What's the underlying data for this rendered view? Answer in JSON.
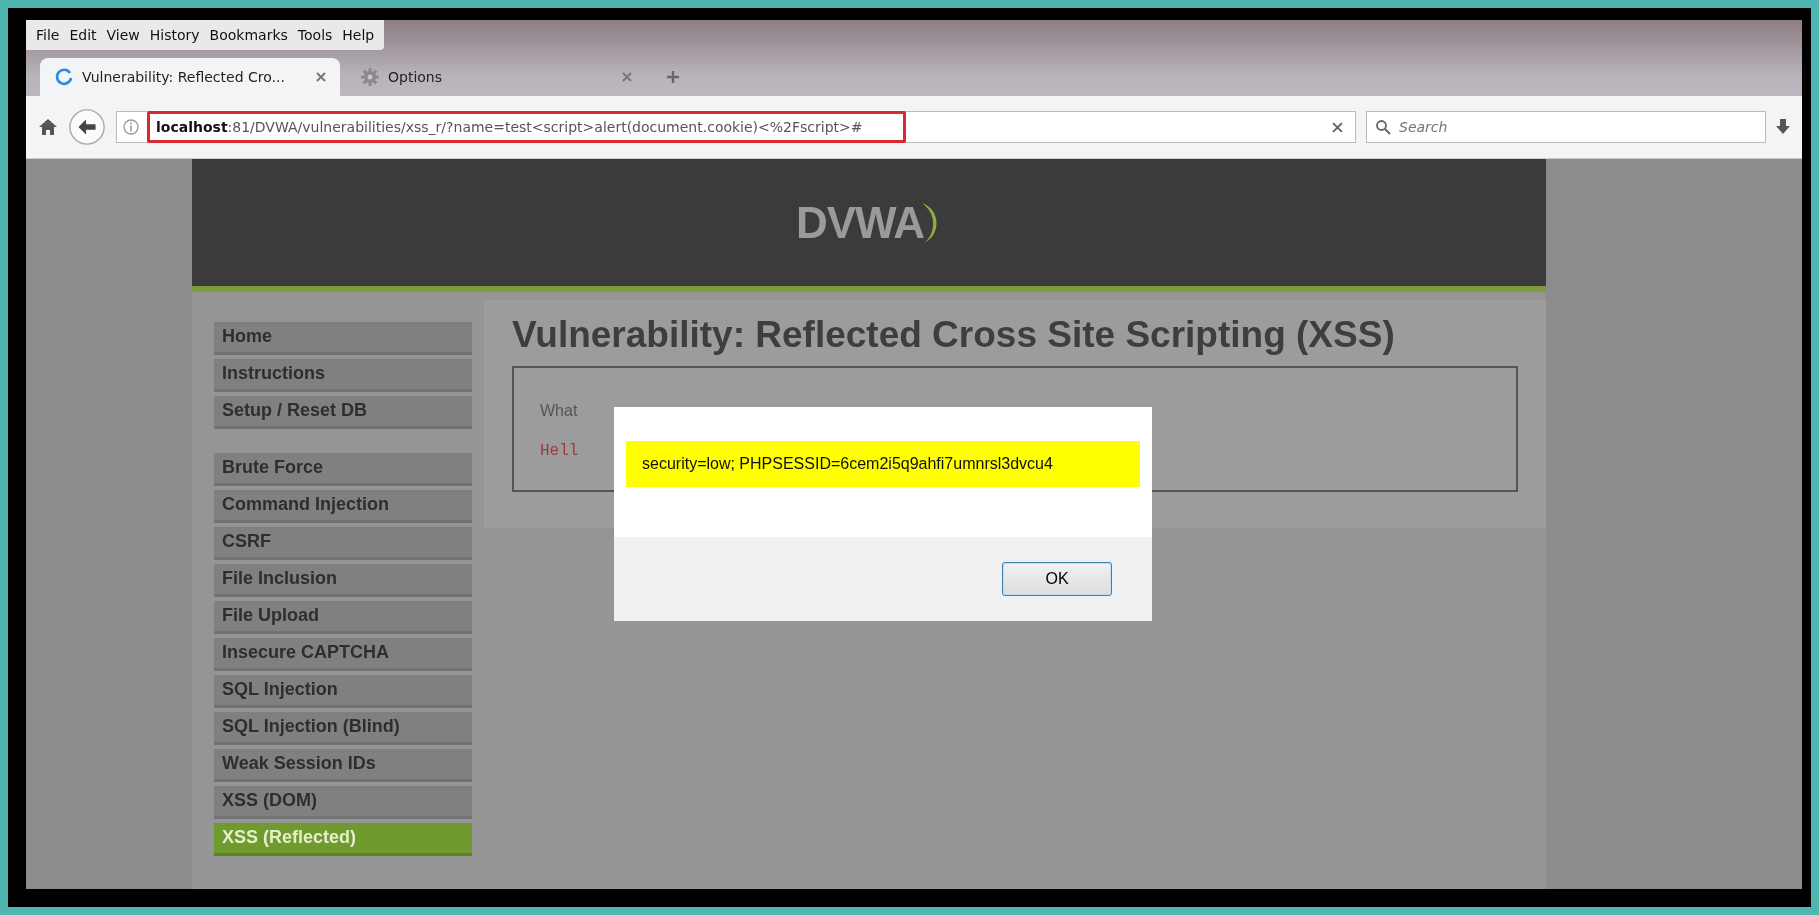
{
  "menu_bar": [
    "File",
    "Edit",
    "View",
    "History",
    "Bookmarks",
    "Tools",
    "Help"
  ],
  "tabs": [
    {
      "title": "Vulnerability: Reflected Cro...",
      "selected": true,
      "kind": "loading"
    },
    {
      "title": "Options",
      "selected": false,
      "kind": "settings"
    }
  ],
  "address_bar": {
    "host": "localhost",
    "path": ":81/DVWA/vulnerabilities/xss_r/?name=test<script>alert(document.cookie)<%2Fscript>#",
    "highlighted": true
  },
  "search": {
    "placeholder": "Search"
  },
  "page": {
    "logo": "DVWA",
    "heading": "Vulnerability: Reflected Cross Site Scripting (XSS)",
    "sidebar": [
      [
        {
          "label": "Home",
          "selected": false
        },
        {
          "label": "Instructions",
          "selected": false
        },
        {
          "label": "Setup / Reset DB",
          "selected": false
        }
      ],
      [
        {
          "label": "Brute Force",
          "selected": false
        },
        {
          "label": "Command Injection",
          "selected": false
        },
        {
          "label": "CSRF",
          "selected": false
        },
        {
          "label": "File Inclusion",
          "selected": false
        },
        {
          "label": "File Upload",
          "selected": false
        },
        {
          "label": "Insecure CAPTCHA",
          "selected": false
        },
        {
          "label": "SQL Injection",
          "selected": false
        },
        {
          "label": "SQL Injection (Blind)",
          "selected": false
        },
        {
          "label": "Weak Session IDs",
          "selected": false
        },
        {
          "label": "XSS (DOM)",
          "selected": false
        },
        {
          "label": "XSS (Reflected)",
          "selected": true
        }
      ]
    ],
    "content_lines": [
      {
        "text": "What",
        "kind": "prompt"
      },
      {
        "text": "Hell",
        "kind": "output"
      }
    ]
  },
  "dialog": {
    "message": "security=low; PHPSESSID=6cem2i5q9ahfi7umnrsl3dvcu4",
    "highlighted": true,
    "button": "OK"
  }
}
